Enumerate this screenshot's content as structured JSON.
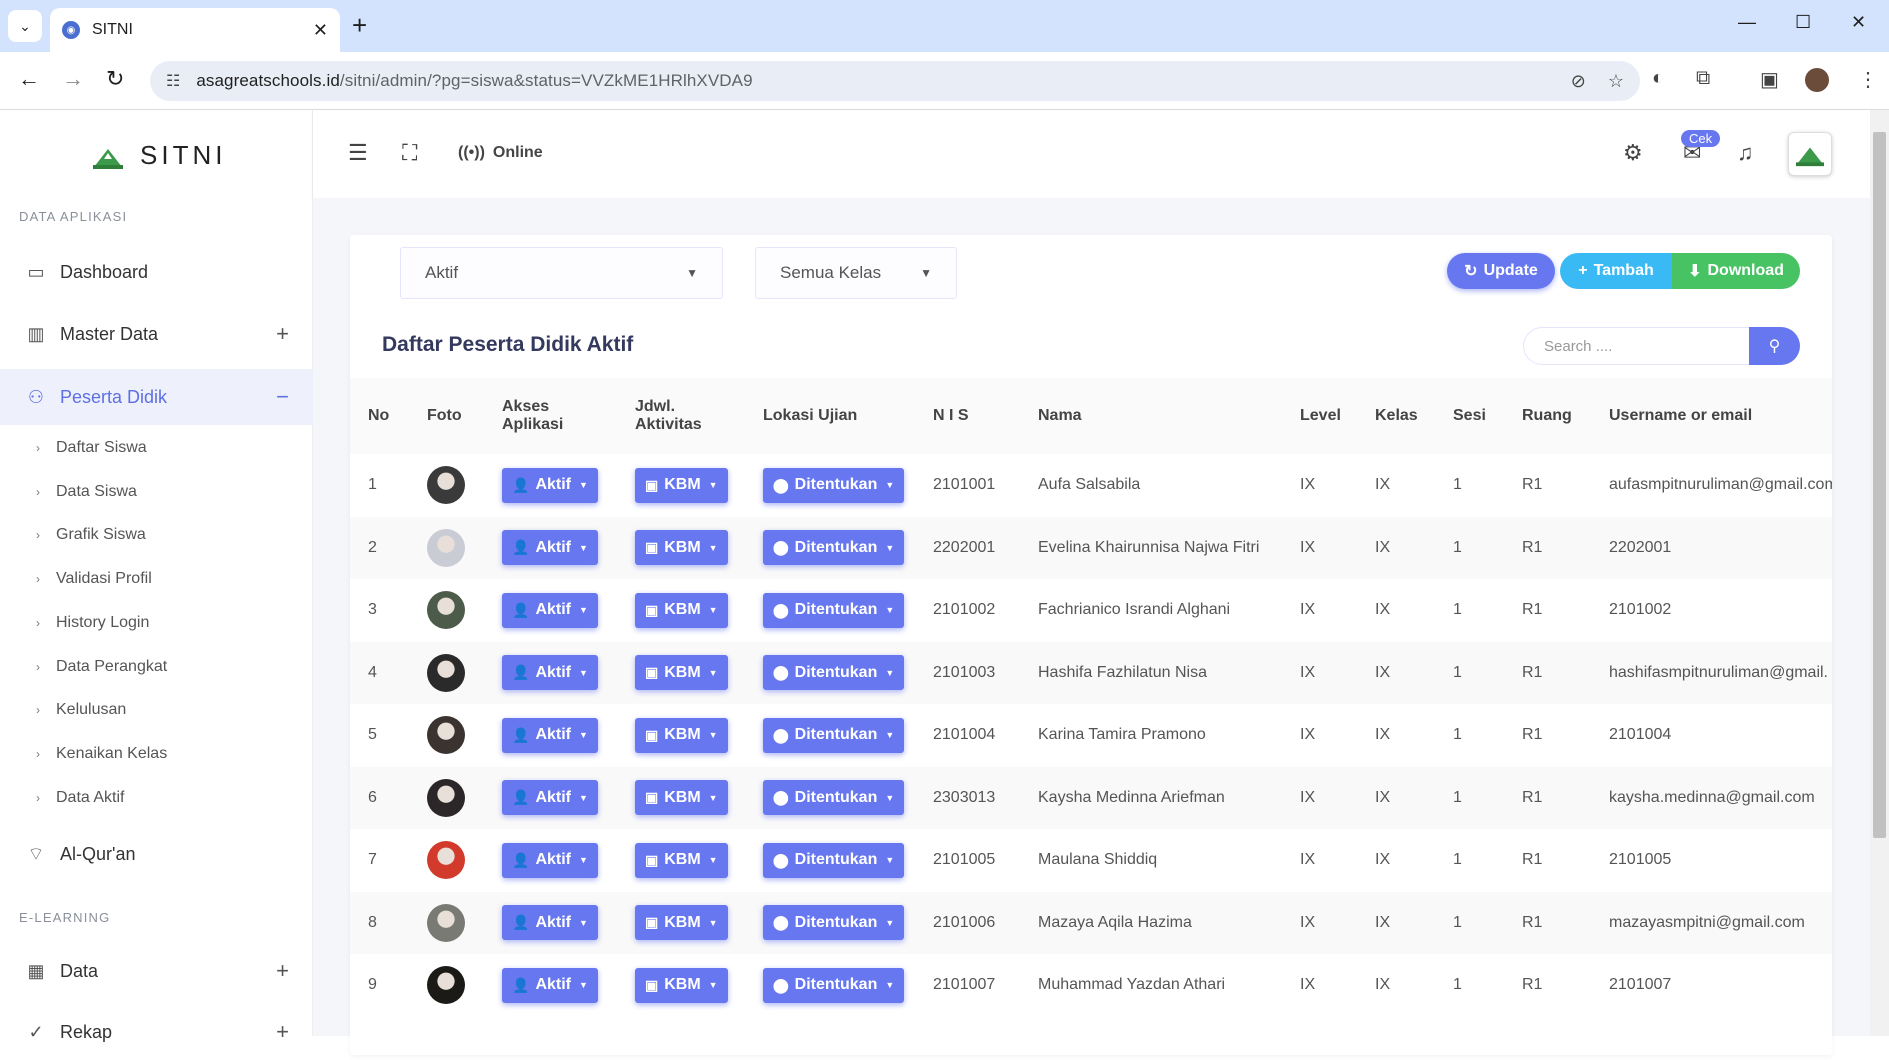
{
  "browser": {
    "tab_title": "SITNI",
    "url_host": "asagreatschools.id",
    "url_path": "/sitni/admin/?pg=siswa&status=VVZkME1HRlhXVDA9"
  },
  "brand": {
    "name": "SITNI"
  },
  "sidebar": {
    "section_app": "DATA APLIKASI",
    "section_elearning": "E-LEARNING",
    "items": [
      {
        "label": "Dashboard",
        "icon": "monitor-icon"
      },
      {
        "label": "Master Data",
        "icon": "building-icon",
        "expand": "+"
      },
      {
        "label": "Peserta Didik",
        "icon": "users-icon",
        "expand": "−"
      },
      {
        "label": "Al-Qur'an",
        "icon": "cast-icon"
      },
      {
        "label": "Data",
        "icon": "table-icon",
        "expand": "+"
      },
      {
        "label": "Rekap",
        "icon": "check-circle-icon",
        "expand": "+"
      }
    ],
    "subitems": [
      "Daftar Siswa",
      "Data Siswa",
      "Grafik Siswa",
      "Validasi Profil",
      "History Login",
      "Data Perangkat",
      "Kelulusan",
      "Kenaikan Kelas",
      "Data Aktif"
    ]
  },
  "topbar": {
    "online_label": "Online",
    "cek_badge": "Cek"
  },
  "filters": {
    "status": "Aktif",
    "kelas": "Semua Kelas"
  },
  "actions": {
    "update": "Update",
    "tambah": "Tambah",
    "download": "Download"
  },
  "card": {
    "title": "Daftar Peserta Didik Aktif"
  },
  "search": {
    "placeholder": "Search ...."
  },
  "table": {
    "headers": {
      "no": "No",
      "foto": "Foto",
      "akses_1": "Akses",
      "akses_2": "Aplikasi",
      "jdwl_1": "Jdwl.",
      "jdwl_2": "Aktivitas",
      "lokasi": "Lokasi Ujian",
      "nis": "N I S",
      "nama": "Nama",
      "level": "Level",
      "kelas": "Kelas",
      "sesi": "Sesi",
      "ruang": "Ruang",
      "username": "Username or email"
    },
    "btn_akses": "Aktif",
    "btn_jdwl": "KBM",
    "btn_lokasi": "Ditentukan",
    "rows": [
      {
        "no": "1",
        "nis": "2101001",
        "nama": "Aufa Salsabila",
        "level": "IX",
        "kelas": "IX",
        "sesi": "1",
        "ruang": "R1",
        "username": "aufasmpitnuruliman@gmail.com",
        "photo": "#3a3a3a"
      },
      {
        "no": "2",
        "nis": "2202001",
        "nama": "Evelina Khairunnisa Najwa Fitri",
        "level": "IX",
        "kelas": "IX",
        "sesi": "1",
        "ruang": "R1",
        "username": "2202001",
        "photo": "#c9ccd4"
      },
      {
        "no": "3",
        "nis": "2101002",
        "nama": "Fachrianico Israndi Alghani",
        "level": "IX",
        "kelas": "IX",
        "sesi": "1",
        "ruang": "R1",
        "username": "2101002",
        "photo": "#4d5b4a"
      },
      {
        "no": "4",
        "nis": "2101003",
        "nama": "Hashifa Fazhilatun Nisa",
        "level": "IX",
        "kelas": "IX",
        "sesi": "1",
        "ruang": "R1",
        "username": "hashifasmpitnuruliman@gmail.",
        "photo": "#2a2a2a"
      },
      {
        "no": "5",
        "nis": "2101004",
        "nama": "Karina Tamira Pramono",
        "level": "IX",
        "kelas": "IX",
        "sesi": "1",
        "ruang": "R1",
        "username": "2101004",
        "photo": "#3b3330"
      },
      {
        "no": "6",
        "nis": "2303013",
        "nama": "Kaysha Medinna Ariefman",
        "level": "IX",
        "kelas": "IX",
        "sesi": "1",
        "ruang": "R1",
        "username": "kaysha.medinna@gmail.com",
        "photo": "#2b2628"
      },
      {
        "no": "7",
        "nis": "2101005",
        "nama": "Maulana Shiddiq",
        "level": "IX",
        "kelas": "IX",
        "sesi": "1",
        "ruang": "R1",
        "username": "2101005",
        "photo": "#d23a2c"
      },
      {
        "no": "8",
        "nis": "2101006",
        "nama": "Mazaya Aqila Hazima",
        "level": "IX",
        "kelas": "IX",
        "sesi": "1",
        "ruang": "R1",
        "username": "mazayasmpitni@gmail.com",
        "photo": "#7a7a75"
      },
      {
        "no": "9",
        "nis": "2101007",
        "nama": "Muhammad Yazdan Athari",
        "level": "IX",
        "kelas": "IX",
        "sesi": "1",
        "ruang": "R1",
        "username": "2101007",
        "photo": "#1c1a16"
      }
    ]
  },
  "colors": {
    "primary": "#6777ef",
    "info": "#3abaf4",
    "success": "#47c363"
  }
}
